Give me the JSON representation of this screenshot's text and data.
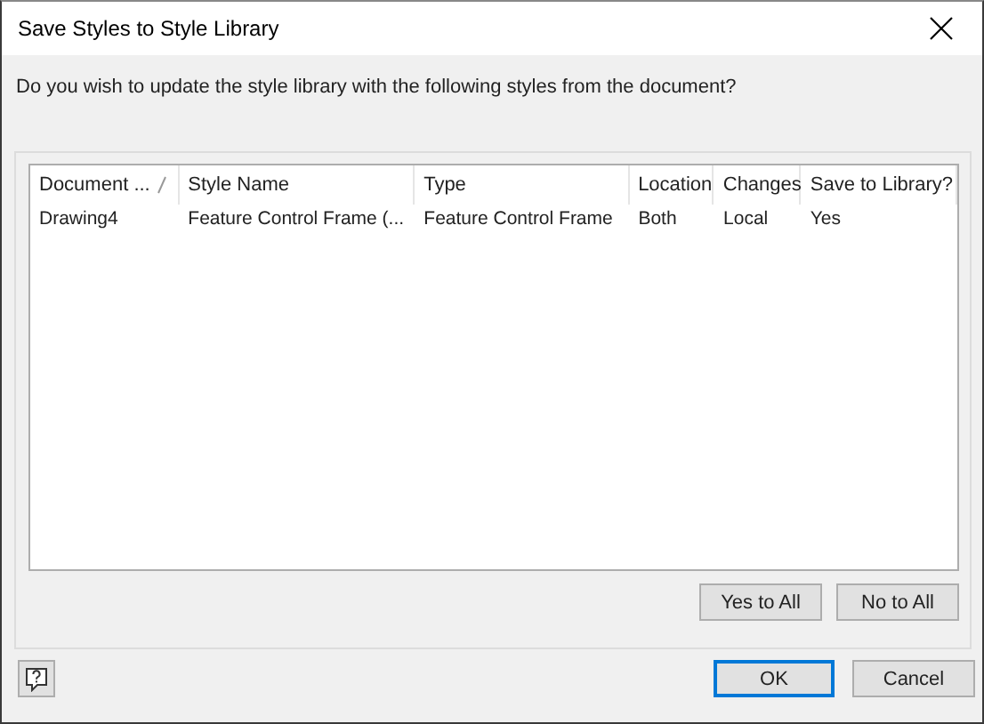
{
  "window": {
    "title": "Save Styles to Style Library"
  },
  "prompt": "Do you wish to update the style library with the following styles from the document?",
  "table": {
    "columns": [
      {
        "label": "Document ...",
        "sorted": true
      },
      {
        "label": "Style Name",
        "sorted": false
      },
      {
        "label": "Type",
        "sorted": false
      },
      {
        "label": "Location",
        "sorted": false
      },
      {
        "label": "Changes",
        "sorted": false
      },
      {
        "label": "Save to Library?",
        "sorted": false
      }
    ],
    "rows": [
      [
        "Drawing4",
        "Feature Control Frame (...",
        "Feature Control Frame",
        "Both",
        "Local",
        "Yes"
      ]
    ]
  },
  "list_buttons": [
    "Yes to All",
    "No to All"
  ],
  "dialog_buttons": [
    {
      "label": "OK",
      "default": true
    },
    {
      "label": "Cancel",
      "default": false
    }
  ]
}
